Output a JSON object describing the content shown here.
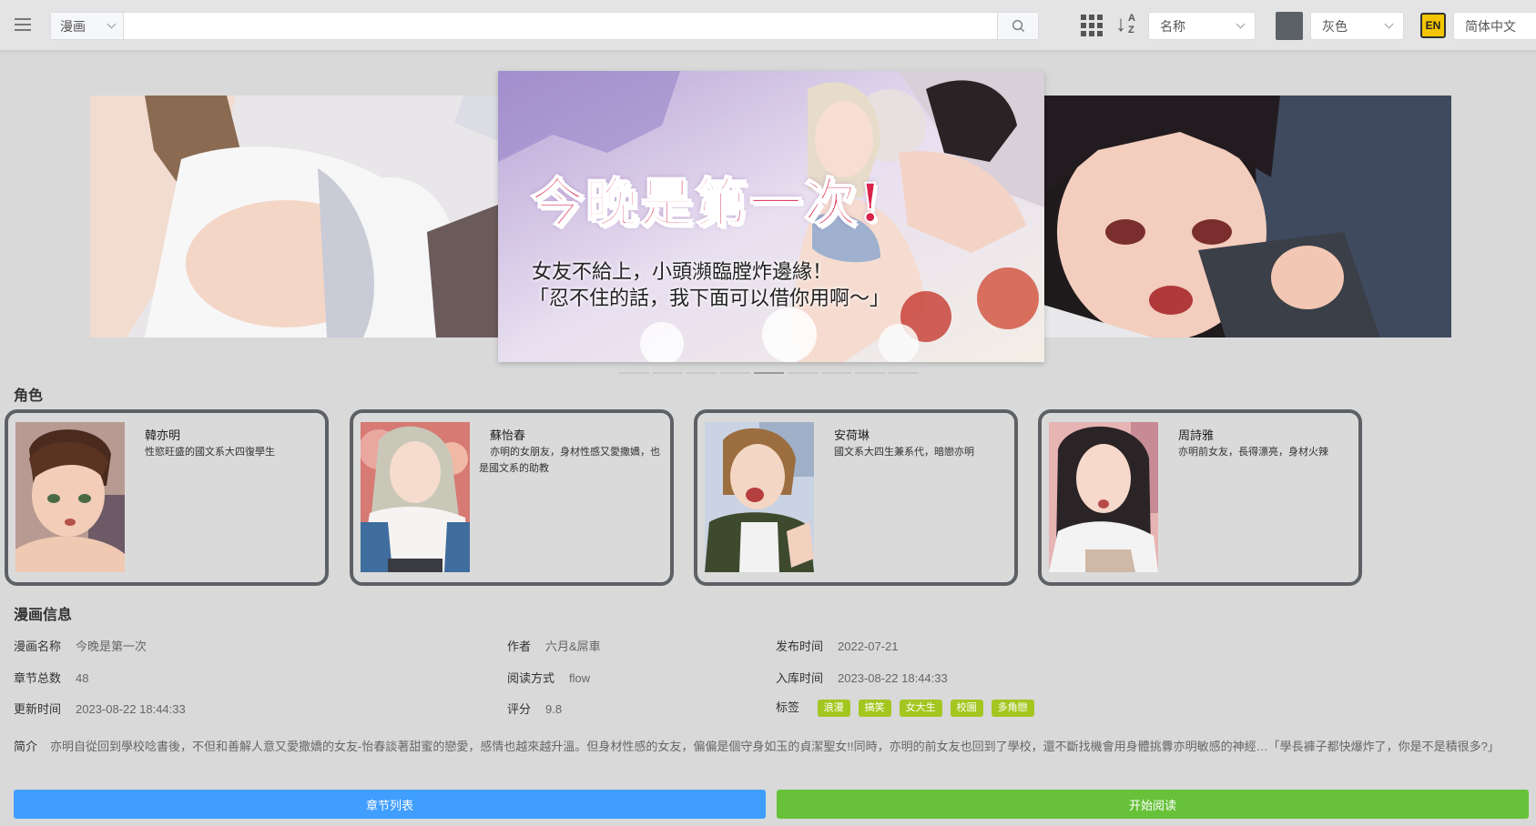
{
  "toolbar": {
    "search_type": "漫画",
    "search_placeholder": "",
    "sort_field": "名称",
    "theme_color": "灰色",
    "theme_swatch": "#5b6166",
    "lang_badge": "EN",
    "language": "简体中文",
    "sort_az": "A\nZ"
  },
  "banner": {
    "title": "今晚是第一次!",
    "subtitle_1": "女友不給上，小頭瀕臨膛炸邊緣！",
    "subtitle_2": "「忍不住的話，我下面可以借你用啊～」",
    "dot_count": 9,
    "active_dot": 4
  },
  "characters_heading": "角色",
  "characters": [
    {
      "name": "韓亦明",
      "desc": "性慾旺盛的國文系大四復學生"
    },
    {
      "name": "蘇怡春",
      "desc": "亦明的女朋友，身材性感又愛撒嬌，也是國文系的助教"
    },
    {
      "name": "安荷琳",
      "desc": "國文系大四生兼系代，暗戀亦明"
    },
    {
      "name": "周詩雅",
      "desc": "亦明前女友，長得漂亮，身材火辣"
    }
  ],
  "info_heading": "漫画信息",
  "info": {
    "name_label": "漫画名称",
    "name": "今晚是第一次",
    "author_label": "作者",
    "author": "六月&屌車",
    "publish_label": "发布时间",
    "publish": "2022-07-21",
    "chapters_label": "章节总数",
    "chapters": "48",
    "mode_label": "阅读方式",
    "mode": "flow",
    "stored_label": "入库时间",
    "stored": "2023-08-22 18:44:33",
    "updated_label": "更新时间",
    "updated": "2023-08-22 18:44:33",
    "rating_label": "评分",
    "rating": "9.8",
    "tags_label": "标签",
    "tags": [
      "浪漫",
      "搞笑",
      "女大生",
      "校園",
      "多角戀"
    ]
  },
  "synopsis_label": "简介",
  "synopsis": "亦明自從回到學校唸書後，不但和善解人意又愛撒嬌的女友-怡春談著甜蜜的戀愛，感情也越來越升溫。但身材性感的女友，偏偏是個守身如玉的貞潔聖女!!同時，亦明的前女友也回到了學校，還不斷找機會用身體挑釁亦明敏感的神經…「學長褲子都快爆炸了，你是不是積很多?」",
  "buttons": {
    "chapters": "章节列表",
    "read": "开始阅读"
  }
}
